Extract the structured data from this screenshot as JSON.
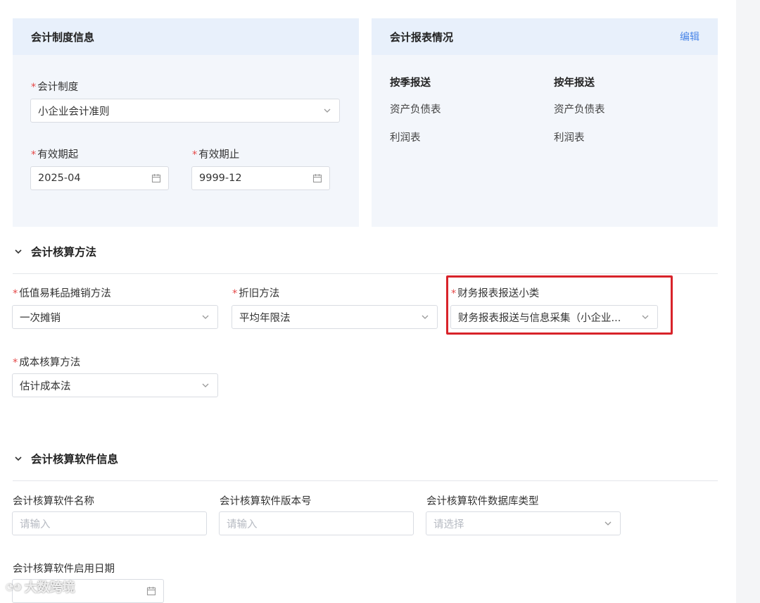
{
  "accounting_system_card": {
    "title": "会计制度信息",
    "system_label": "会计制度",
    "system_value": "小企业会计准则",
    "start_label": "有效期起",
    "start_value": "2025-04",
    "end_label": "有效期止",
    "end_value": "9999-12"
  },
  "report_card": {
    "title": "会计报表情况",
    "edit_label": "编辑",
    "columns": [
      {
        "heading": "按季报送",
        "items": [
          "资产负债表",
          "利润表"
        ]
      },
      {
        "heading": "按年报送",
        "items": [
          "资产负债表",
          "利润表"
        ]
      }
    ]
  },
  "accounting_methods": {
    "title": "会计核算方法",
    "low_value_label": "低值易耗品摊销方法",
    "low_value_value": "一次摊销",
    "depreciation_label": "折旧方法",
    "depreciation_value": "平均年限法",
    "report_subtype_label": "财务报表报送小类",
    "report_subtype_value": "财务报表报送与信息采集（小企业...",
    "cost_label": "成本核算方法",
    "cost_value": "估计成本法"
  },
  "software_info": {
    "title": "会计核算软件信息",
    "name_label": "会计核算软件名称",
    "name_placeholder": "请输入",
    "version_label": "会计核算软件版本号",
    "version_placeholder": "请输入",
    "db_label": "会计核算软件数据库类型",
    "db_placeholder": "请选择",
    "start_date_label": "会计核算软件启用日期"
  },
  "required_mark": "*",
  "watermark": "大数跨境",
  "colors": {
    "required": "#e54848",
    "link": "#4a86e8",
    "highlight": "#d8232a",
    "card_bg": "#f3f6fb",
    "card_head_bg": "#e8f0fb"
  }
}
